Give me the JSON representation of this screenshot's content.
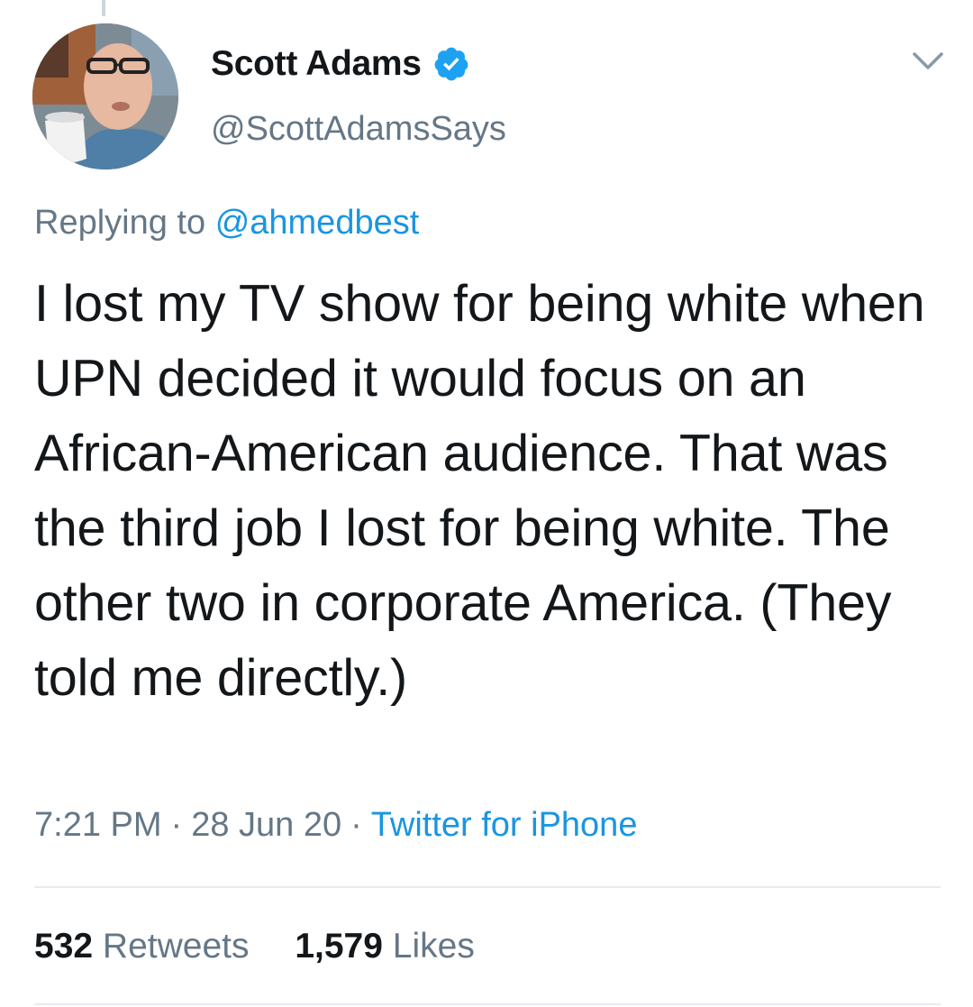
{
  "tweet": {
    "author": {
      "display_name": "Scott Adams",
      "handle": "@ScottAdamsSays",
      "verified": true,
      "avatar_icon": "profile-photo"
    },
    "replying_to": {
      "prefix": "Replying to",
      "mention": "@ahmedbest"
    },
    "text": "I lost my TV show for being white when UPN decided it would focus on an African-American audience. That was the third job I lost for being white. The other two in corporate America. (They told me directly.)",
    "meta": {
      "time": "7:21 PM",
      "date": "28 Jun 20",
      "separator": "·",
      "source": "Twitter for iPhone"
    },
    "stats": {
      "retweets_count": "532",
      "retweets_label": "Retweets",
      "likes_count": "1,579",
      "likes_label": "Likes"
    }
  },
  "colors": {
    "text_primary": "#14171a",
    "text_secondary": "#657786",
    "link": "#1b95e0",
    "verified": "#1da1f2",
    "divider": "#e6ecf0"
  },
  "icons": {
    "verified": "verified-badge-icon",
    "menu": "chevron-down-icon"
  }
}
